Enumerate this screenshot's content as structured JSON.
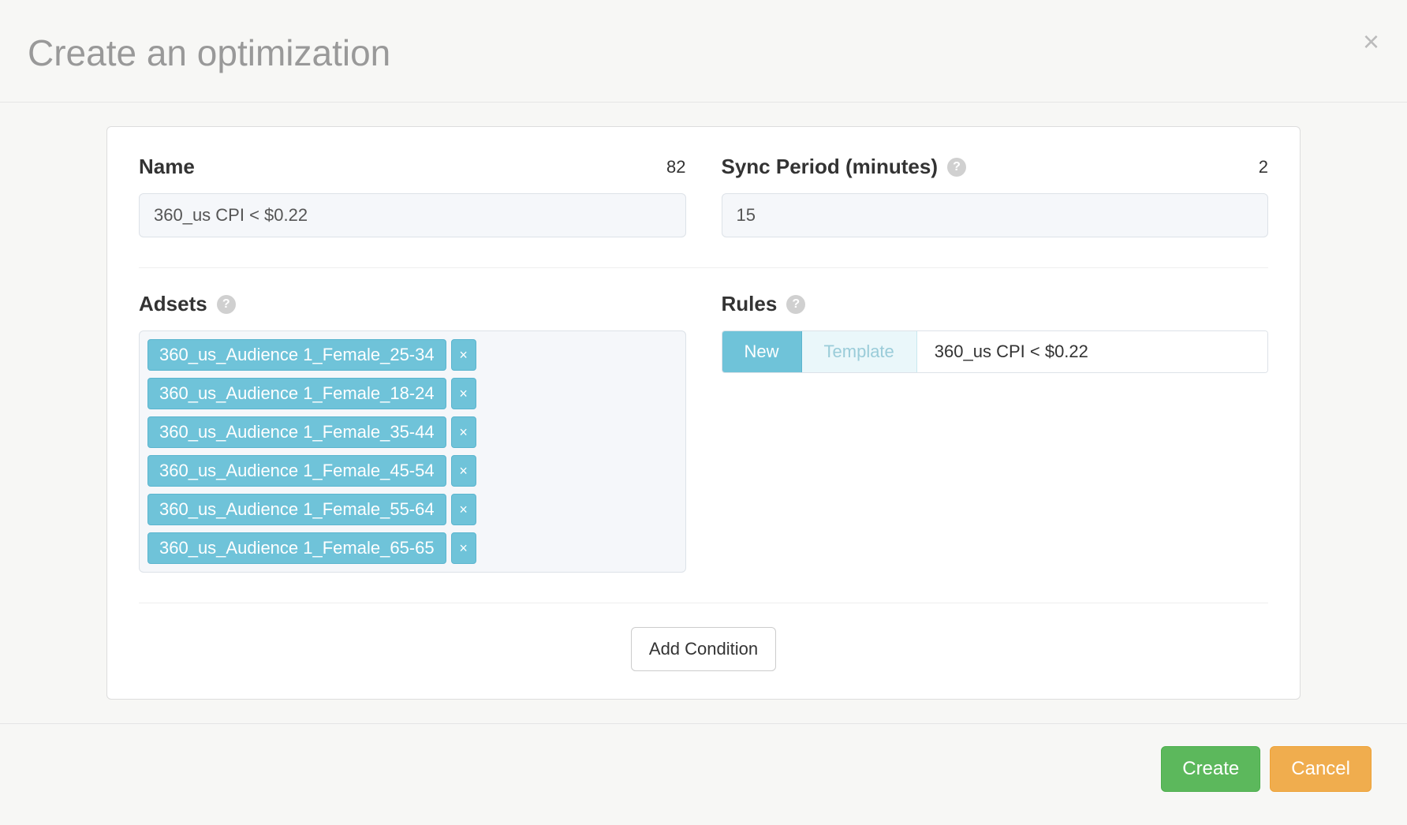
{
  "header": {
    "title": "Create an optimization"
  },
  "form": {
    "name": {
      "label": "Name",
      "counter": "82",
      "value": "360_us CPI < $0.22"
    },
    "sync_period": {
      "label": "Sync Period (minutes)",
      "counter": "2",
      "value": "15"
    },
    "adsets": {
      "label": "Adsets",
      "tags": [
        "360_us_Audience 1_Female_25-34",
        "360_us_Audience 1_Female_18-24",
        "360_us_Audience 1_Female_35-44",
        "360_us_Audience 1_Female_45-54",
        "360_us_Audience 1_Female_55-64",
        "360_us_Audience 1_Female_65-65"
      ]
    },
    "rules": {
      "label": "Rules",
      "new_button": "New",
      "template_button": "Template",
      "value": "360_us CPI < $0.22"
    },
    "add_condition_button": "Add Condition"
  },
  "footer": {
    "create_button": "Create",
    "cancel_button": "Cancel"
  }
}
